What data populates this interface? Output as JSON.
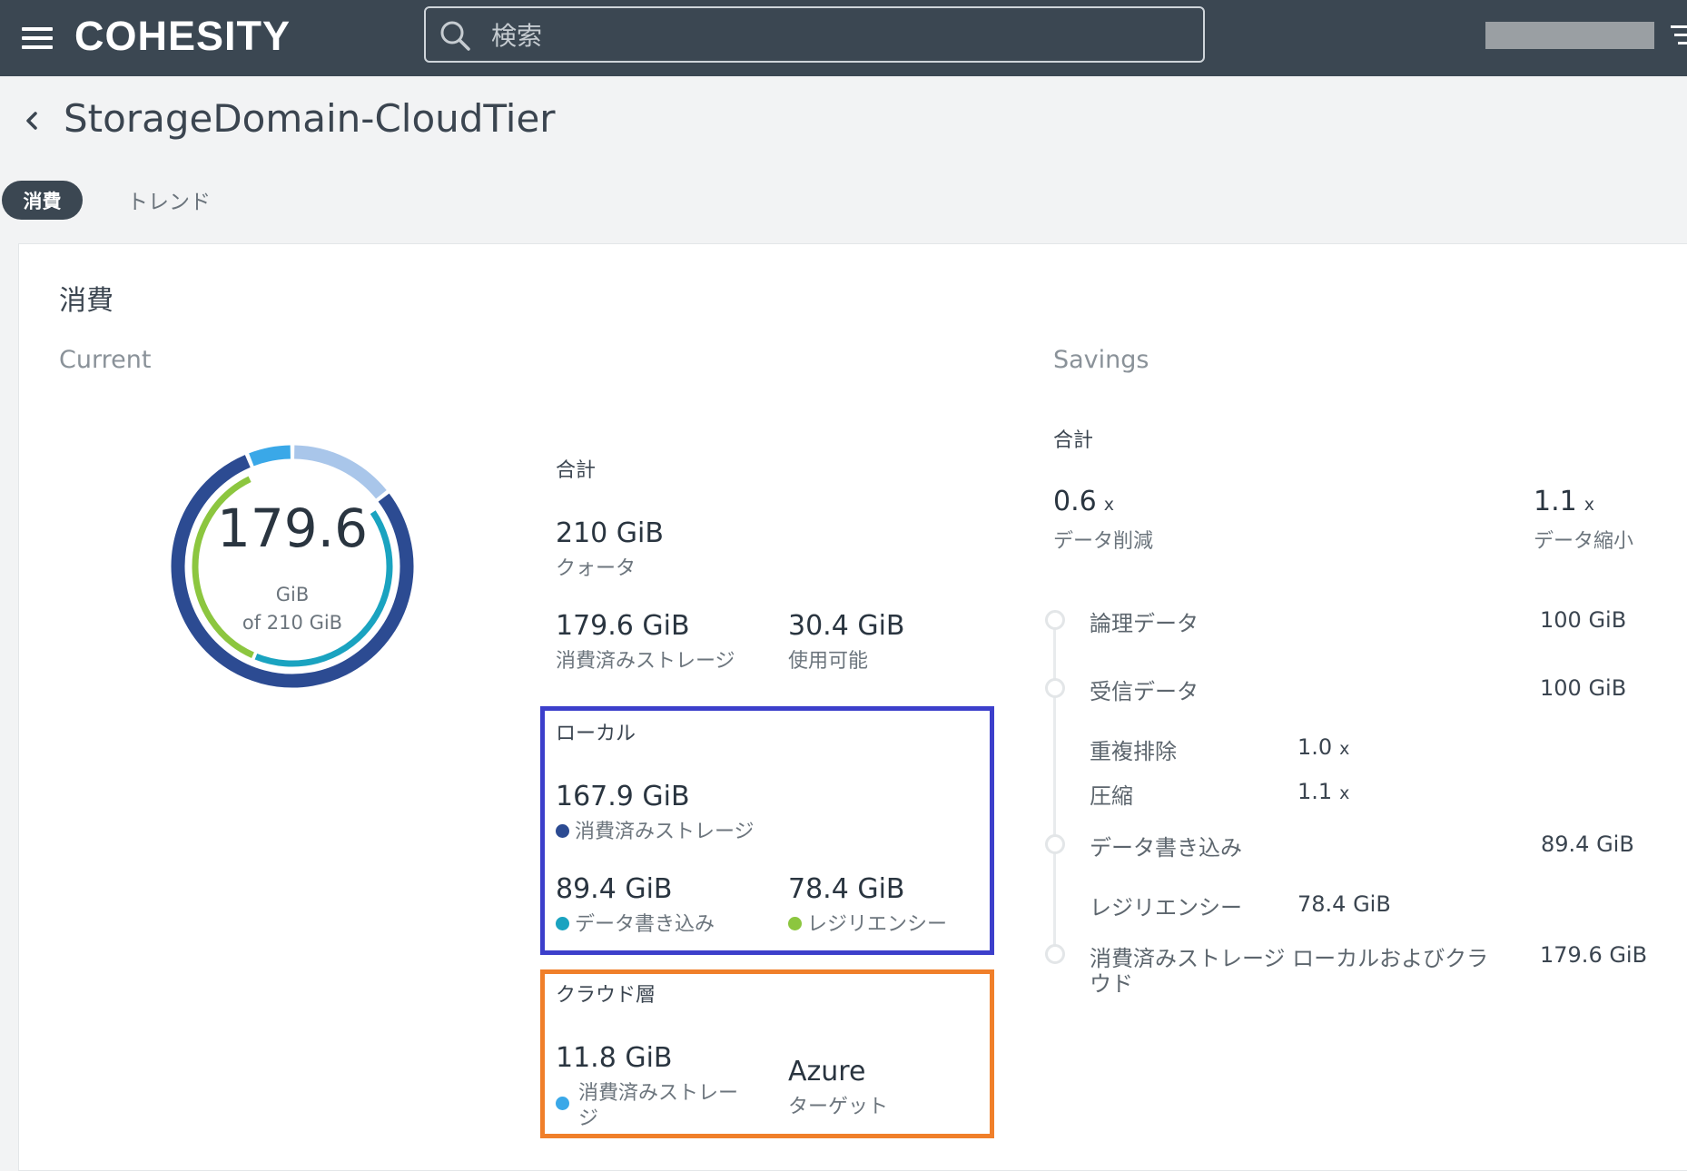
{
  "header": {
    "logo": "COHESITY",
    "search_placeholder": "検索"
  },
  "page": {
    "title": "StorageDomain-CloudTier",
    "tabs": [
      {
        "label": "消費",
        "active": true
      },
      {
        "label": "トレンド",
        "active": false
      }
    ]
  },
  "consumption": {
    "section_title": "消費",
    "current_label": "Current",
    "donut": {
      "value": "179.6",
      "unit": "GiB",
      "of_text": "of 210 GiB"
    },
    "total": {
      "heading": "合計",
      "quota_value": "210 GiB",
      "quota_label": "クォータ",
      "consumed_value": "179.6 GiB",
      "consumed_label": "消費済みストレージ",
      "available_value": "30.4 GiB",
      "available_label": "使用可能"
    },
    "local": {
      "heading": "ローカル",
      "consumed_value": "167.9 GiB",
      "consumed_label": "消費済みストレージ",
      "data_written_value": "89.4 GiB",
      "data_written_label": "データ書き込み",
      "resiliency_value": "78.4 GiB",
      "resiliency_label": "レジリエンシー"
    },
    "cloud": {
      "heading": "クラウド層",
      "consumed_value": "11.8 GiB",
      "consumed_label_line1": "消費済みストレー",
      "consumed_label_line2": "ジ",
      "target_value": "Azure",
      "target_label": "ターゲット"
    }
  },
  "savings": {
    "label": "Savings",
    "total_heading": "合計",
    "reduction_value": "0.6",
    "reduction_mult": "x",
    "reduction_label": "データ削減",
    "compression_value": "1.1",
    "compression_mult": "x",
    "compression_label": "データ縮小",
    "rows": {
      "logical_label": "論理データ",
      "logical_value": "100 GiB",
      "ingested_label": "受信データ",
      "ingested_value": "100 GiB",
      "dedup_label": "重複排除",
      "dedup_value": "1.0",
      "dedup_mult": "x",
      "comp_label": "圧縮",
      "comp_value": "1.1",
      "comp_mult": "x",
      "written_label": "データ書き込み",
      "written_value": "89.4 GiB",
      "resiliency_label": "レジリエンシー",
      "resiliency_value": "78.4 GiB",
      "consumed_label_line1": "消費済みストレージ ローカルおよびクラ",
      "consumed_label_line2": "ウド",
      "consumed_value": "179.6 GiB"
    }
  },
  "colors": {
    "consumed_local": "#2c4b92",
    "data_written": "#1aa3c0",
    "resiliency": "#8cc63f",
    "cloud": "#3aa8e8",
    "available": "#a9c6ea",
    "box_local": "#3c3fcb",
    "box_cloud": "#f07f2a"
  }
}
